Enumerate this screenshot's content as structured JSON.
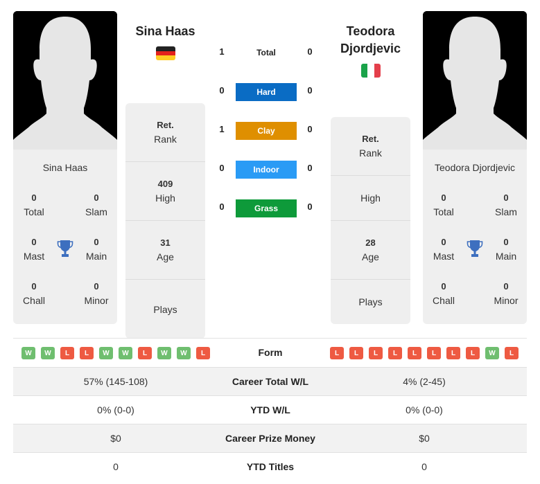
{
  "colors": {
    "hard": "#0a6cc4",
    "clay": "#df8f00",
    "indoor": "#2a9bf5",
    "grass": "#0e9a3a",
    "win": "#6fbe6f",
    "loss": "#ee5a42",
    "trophy": "#3d6fbf"
  },
  "player1": {
    "name": "Sina Haas",
    "flag": "germany-flag",
    "card_name": "Sina Haas",
    "titles": {
      "total": {
        "value": "0",
        "label": "Total"
      },
      "slam": {
        "value": "0",
        "label": "Slam"
      },
      "mast": {
        "value": "0",
        "label": "Mast"
      },
      "main": {
        "value": "0",
        "label": "Main"
      },
      "chall": {
        "value": "0",
        "label": "Chall"
      },
      "minor": {
        "value": "0",
        "label": "Minor"
      }
    },
    "rank": {
      "value": "Ret.",
      "label": "Rank"
    },
    "high": {
      "value": "409",
      "label": "High"
    },
    "age": {
      "value": "31",
      "label": "Age"
    },
    "plays": {
      "value": "",
      "label": "Plays"
    },
    "form": [
      "W",
      "W",
      "L",
      "L",
      "W",
      "W",
      "L",
      "W",
      "W",
      "L"
    ]
  },
  "player2": {
    "name_line1": "Teodora",
    "name_line2": "Djordjevic",
    "flag": "italy-flag",
    "card_name": "Teodora Djordjevic",
    "titles": {
      "total": {
        "value": "0",
        "label": "Total"
      },
      "slam": {
        "value": "0",
        "label": "Slam"
      },
      "mast": {
        "value": "0",
        "label": "Mast"
      },
      "main": {
        "value": "0",
        "label": "Main"
      },
      "chall": {
        "value": "0",
        "label": "Chall"
      },
      "minor": {
        "value": "0",
        "label": "Minor"
      }
    },
    "rank": {
      "value": "Ret.",
      "label": "Rank"
    },
    "high": {
      "value": "",
      "label": "High"
    },
    "age": {
      "value": "28",
      "label": "Age"
    },
    "plays": {
      "value": "",
      "label": "Plays"
    },
    "form": [
      "L",
      "L",
      "L",
      "L",
      "L",
      "L",
      "L",
      "L",
      "W",
      "L"
    ]
  },
  "h2h": {
    "total": {
      "label": "Total",
      "p1": "1",
      "p2": "0"
    },
    "hard": {
      "label": "Hard",
      "p1": "0",
      "p2": "0"
    },
    "clay": {
      "label": "Clay",
      "p1": "1",
      "p2": "0"
    },
    "indoor": {
      "label": "Indoor",
      "p1": "0",
      "p2": "0"
    },
    "grass": {
      "label": "Grass",
      "p1": "0",
      "p2": "0"
    }
  },
  "table": {
    "form_label": "Form",
    "rows": [
      {
        "label": "Career Total W/L",
        "p1": "57% (145-108)",
        "p2": "4% (2-45)"
      },
      {
        "label": "YTD W/L",
        "p1": "0% (0-0)",
        "p2": "0% (0-0)"
      },
      {
        "label": "Career Prize Money",
        "p1": "$0",
        "p2": "$0"
      },
      {
        "label": "YTD Titles",
        "p1": "0",
        "p2": "0"
      }
    ]
  }
}
